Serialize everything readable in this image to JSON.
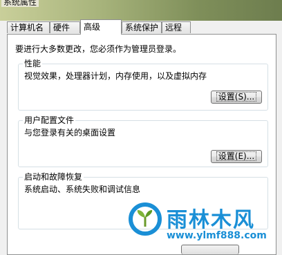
{
  "window": {
    "title": "系统属性"
  },
  "tabs": [
    {
      "label": "计算机名"
    },
    {
      "label": "硬件"
    },
    {
      "label": "高级"
    },
    {
      "label": "系统保护"
    },
    {
      "label": "远程"
    }
  ],
  "panel": {
    "intro": "要进行大多数更改，您必须作为管理员登录。",
    "performance": {
      "title": "性能",
      "description": "视觉效果，处理器计划，内存使用，以及虚拟内存",
      "button": "设置(S)..."
    },
    "profiles": {
      "title": "用户配置文件",
      "description": "与您登录有关的桌面设置",
      "button": "设置(E)..."
    },
    "startup": {
      "title": "启动和故障恢复",
      "description": "系统启动、系统失败和调试信息"
    }
  },
  "watermark": {
    "brand": "雨林木风",
    "url": "www.ylmf888.com"
  },
  "colors": {
    "watermark": "#1a8fd6",
    "tab_border": "#8e8f8f",
    "group_border": "#d5dfe5"
  }
}
